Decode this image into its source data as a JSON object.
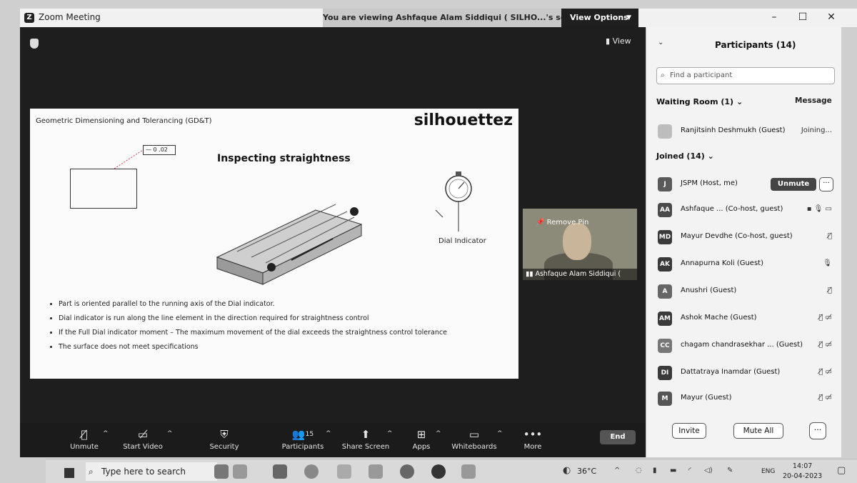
{
  "window": {
    "app_title": "Zoom Meeting",
    "viewing_banner": "You are viewing Ashfaque Alam Siddiqui ( SILHO...'s screen",
    "view_options_label": "View Options",
    "minimize": "–",
    "maximize": "☐",
    "close": "✕"
  },
  "meeting": {
    "view_label": "View",
    "slide": {
      "header": "Geometric Dimensioning and Tolerancing (GD&T)",
      "logo": "silhouettez",
      "title": "Inspecting straightness",
      "gdt_frame": "— 0 .02",
      "dial_label": "Dial Indicator",
      "bullets": [
        "Part is oriented parallel to the running axis of the Dial indicator.",
        "Dial indicator is run along the line element in the direction required for straightness control",
        "If the Full Dial indicator moment – The maximum movement of the dial exceeds the straightness control tolerance",
        "The surface does not meet specifications"
      ]
    },
    "video": {
      "remove_pin_label": "Remove Pin",
      "name": "Ashfaque Alam Siddiqui ("
    }
  },
  "toolbar": {
    "unmute_label": "Unmute",
    "start_video_label": "Start Video",
    "security_label": "Security",
    "participants_label": "Participants",
    "participants_count": "15",
    "share_screen_label": "Share Screen",
    "apps_label": "Apps",
    "whiteboards_label": "Whiteboards",
    "more_label": "More",
    "end_label": "End"
  },
  "panel": {
    "title": "Participants (14)",
    "search_placeholder": "Find a participant",
    "waiting_room_header": "Waiting Room (1)",
    "message_label": "Message",
    "waiting": [
      {
        "name": "Ranjitsinh Deshmukh (Guest)",
        "status": "Joining..."
      }
    ],
    "joined_header": "Joined (14)",
    "unmute_label": "Unmute",
    "more_label": "···",
    "joined": [
      {
        "initials": "J",
        "name": "JSPM (Host, me)",
        "color": "#5a5a5a",
        "status": ""
      },
      {
        "initials": "AA",
        "name": "Ashfaque ... (Co-host, guest)",
        "color": "#4a4a4a",
        "status": "▪ 🎙 ▭"
      },
      {
        "initials": "MD",
        "name": "Mayur Devdhe (Co-host, guest)",
        "color": "#3a3a3a",
        "status": "🎙̸"
      },
      {
        "initials": "AK",
        "name": "Annapurna Koli (Guest)",
        "color": "#3a3a3a",
        "status": "🎙"
      },
      {
        "initials": "A",
        "name": "Anushri (Guest)",
        "color": "#666666",
        "status": "🎙̸"
      },
      {
        "initials": "AM",
        "name": "Ashok Mache (Guest)",
        "color": "#3a3a3a",
        "status": "🎙̸ ▭̸"
      },
      {
        "initials": "CC",
        "name": "chagam chandrasekhar ... (Guest)",
        "color": "#777777",
        "status": "🎙̸ ▭̸"
      },
      {
        "initials": "DI",
        "name": "Dattatraya Inamdar (Guest)",
        "color": "#3a3a3a",
        "status": "🎙̸ ▭̸"
      },
      {
        "initials": "M",
        "name": "Mayur (Guest)",
        "color": "#555555",
        "status": "🎙̸ ▭̸"
      }
    ],
    "invite_label": "Invite",
    "mute_all_label": "Mute All"
  },
  "taskbar": {
    "search_placeholder": "Type here to search",
    "temperature": "36°C",
    "language": "ENG",
    "time": "14:07",
    "date": "20-04-2023"
  }
}
